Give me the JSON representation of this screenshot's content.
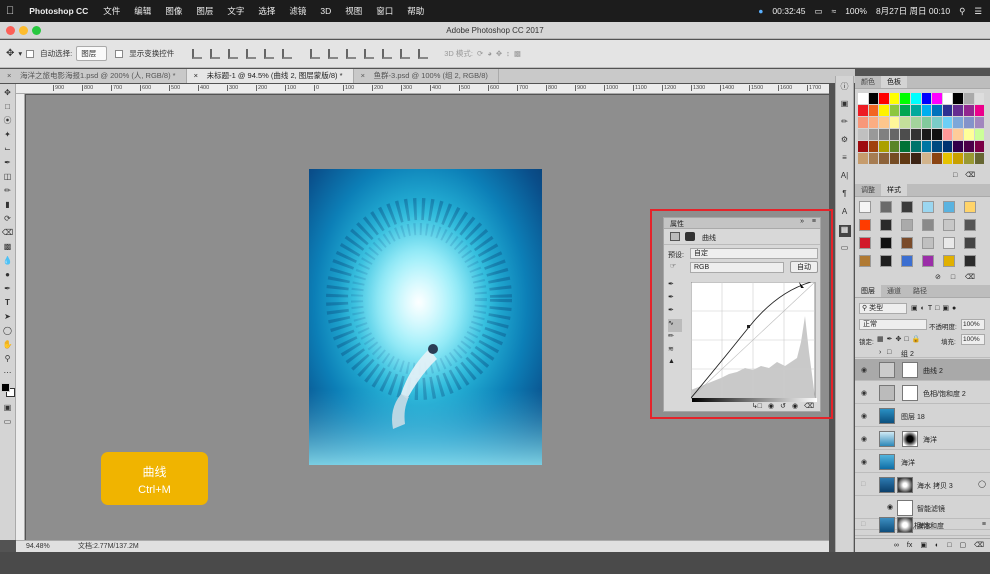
{
  "menubar": {
    "apple": "",
    "app_name": "Photoshop CC",
    "items": [
      "文件",
      "编辑",
      "图像",
      "图层",
      "文字",
      "选择",
      "滤镜",
      "3D",
      "视图",
      "窗口",
      "帮助"
    ],
    "clock": "00:32:45",
    "battery": "100%",
    "date": "8月27日 周日 00:10"
  },
  "window": {
    "title": "Adobe Photoshop CC 2017"
  },
  "options": {
    "auto_select_label": "自动选择:",
    "auto_select_value": "图层",
    "show_transform_label": "显示变换控件",
    "mode_3d_label": "3D 模式:"
  },
  "tabs": [
    {
      "label": "海洋之旅电影海报1.psd @ 200% (人, RGB/8) *"
    },
    {
      "label": "未标题-1 @ 94.5% (曲线 2, 图层蒙版/8) *"
    },
    {
      "label": "鱼群-3.psd @ 100% (组 2, RGB/8)"
    }
  ],
  "ruler_marks": [
    "900",
    "800",
    "700",
    "600",
    "500",
    "400",
    "300",
    "200",
    "100",
    "0",
    "100",
    "200",
    "300",
    "400",
    "500",
    "600",
    "700",
    "800",
    "900",
    "1000",
    "1100",
    "1200",
    "1300",
    "1400",
    "1500",
    "1600",
    "1700",
    "1800"
  ],
  "status": {
    "zoom": "94.48%",
    "doc": "文档:2.77M/137.2M"
  },
  "badge": {
    "title": "曲线",
    "shortcut": "Ctrl+M"
  },
  "properties": {
    "header": "属性",
    "panel_title": "曲线",
    "preset_label": "预设:",
    "preset_value": "自定",
    "channel_value": "RGB",
    "auto_button": "自动"
  },
  "swatch_panel": {
    "tabs": [
      "颜色",
      "色板"
    ]
  },
  "adjust_panel": {
    "tabs": [
      "调整",
      "样式"
    ]
  },
  "layers_panel": {
    "tabs": [
      "图层",
      "通道",
      "路径"
    ],
    "kind_filter": "类型",
    "blend_mode": "正常",
    "opacity_label": "不透明度:",
    "opacity_value": "100%",
    "lock_label": "锁定:",
    "fill_label": "填充:",
    "fill_value": "100%",
    "layers": [
      {
        "name": "组 2"
      },
      {
        "name": "曲线 2"
      },
      {
        "name": "色相/饱和度 2"
      },
      {
        "name": "图层 18"
      },
      {
        "name": "海洋"
      },
      {
        "name": "海洋"
      },
      {
        "name": "海水 拷贝 3"
      },
      {
        "name": "智能滤镜"
      },
      {
        "name": "色相/饱和度"
      },
      {
        "name": "海水"
      }
    ]
  },
  "colors": {
    "highlight_box": "#e5232a",
    "badge": "#f0b400",
    "selected_layer": "#a9a9a9"
  }
}
